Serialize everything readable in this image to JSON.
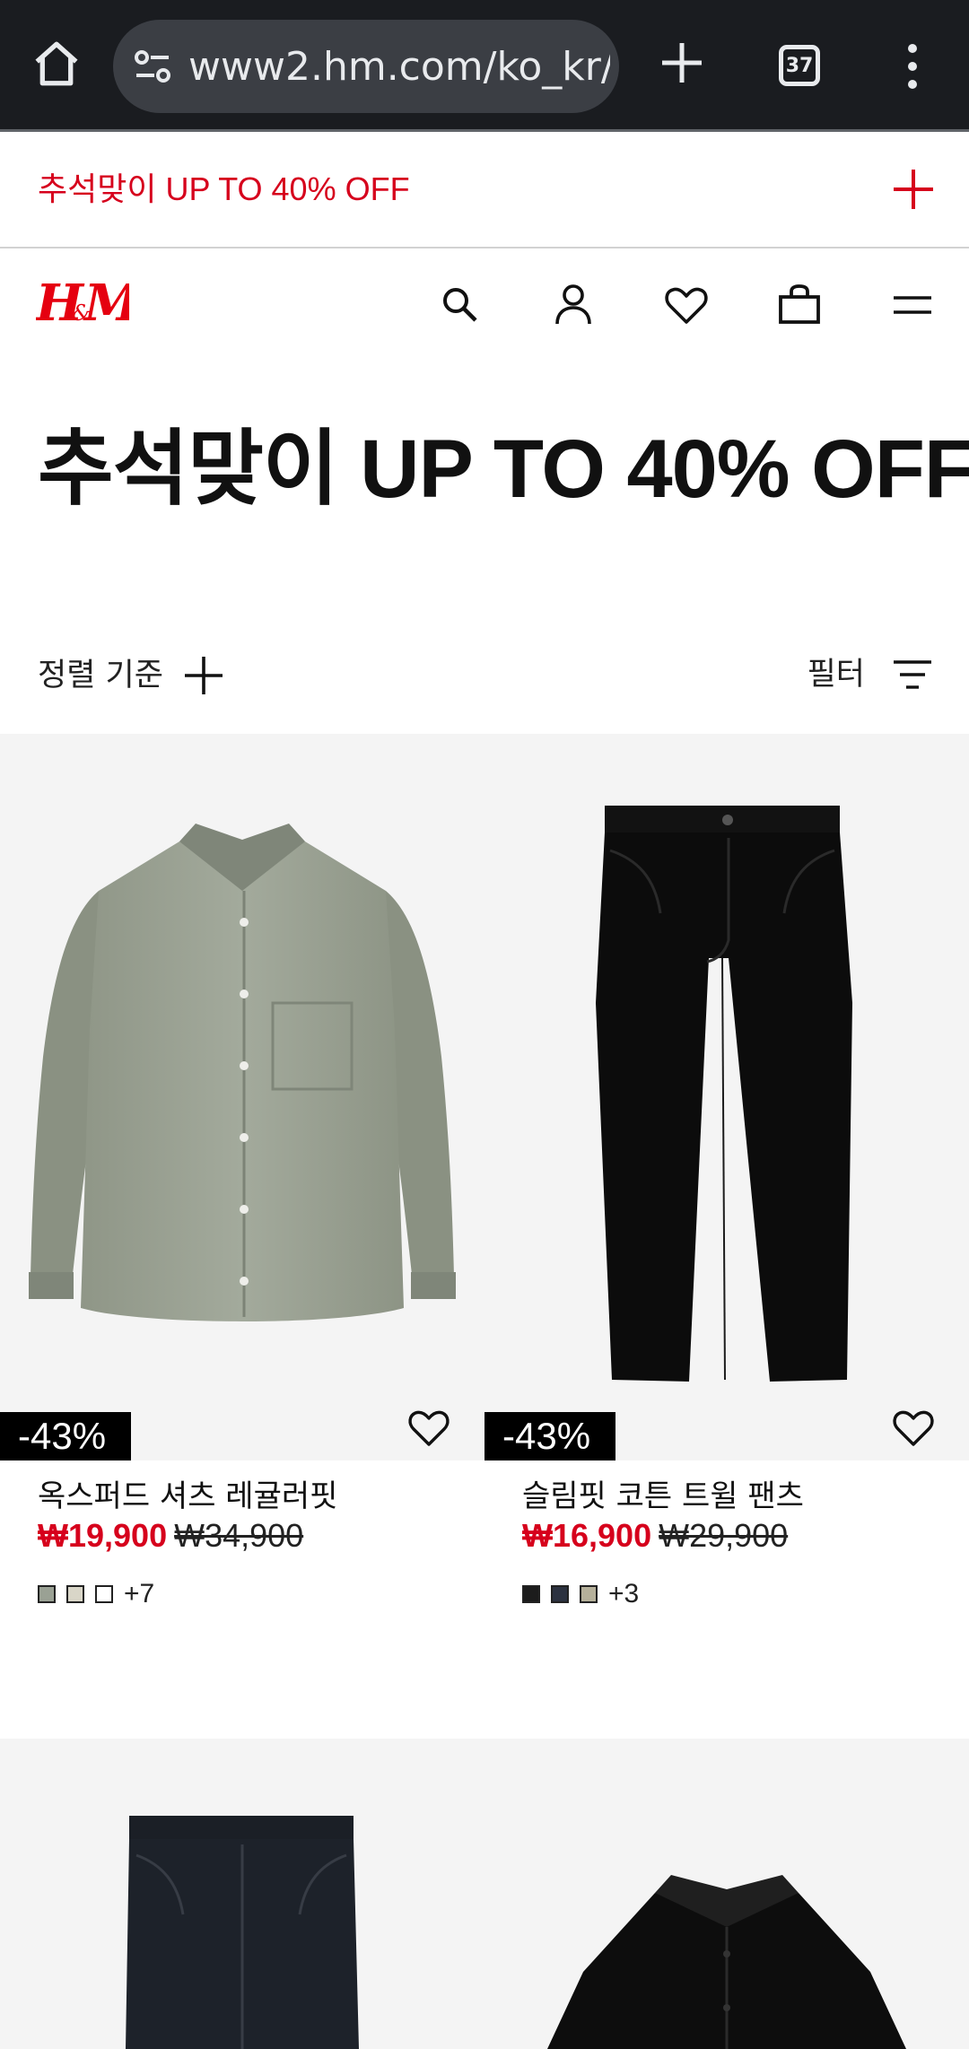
{
  "browser": {
    "url": "www2.hm.com/ko_kr/",
    "tab_count": "37",
    "icons": [
      "home-icon",
      "site-settings-icon",
      "new-tab-icon",
      "tab-switcher-icon",
      "overflow-menu-icon"
    ]
  },
  "promo": {
    "text": "추석맞이 UP TO 40% OFF",
    "accent_color": "#d6001c"
  },
  "header": {
    "logo": "H&M",
    "icons": [
      "search-icon",
      "account-icon",
      "favorites-icon",
      "shopping-bag-icon",
      "hamburger-menu-icon"
    ]
  },
  "page_title": "추석맞이 UP TO 40% OFF",
  "sort": {
    "label": "정렬 기준"
  },
  "filter": {
    "label": "필터"
  },
  "products": [
    {
      "badge": "-43%",
      "name": "옥스퍼드 셔츠 레귤러핏",
      "sale_price": "₩19,900",
      "original_price": "₩34,900",
      "swatches": [
        "#9aa194",
        "#d9d6c8",
        "#ffffff"
      ],
      "more_colors": "+7"
    },
    {
      "badge": "-43%",
      "name": "슬림핏 코튼 트윌 팬츠",
      "sale_price": "₩16,900",
      "original_price": "₩29,900",
      "swatches": [
        "#1c1c1c",
        "#2c3240",
        "#b5b09a"
      ],
      "more_colors": "+3"
    }
  ]
}
